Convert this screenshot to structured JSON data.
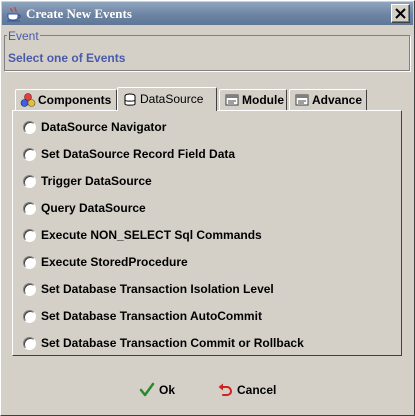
{
  "window": {
    "title": "Create New Events"
  },
  "event": {
    "legend": "Event",
    "text": "Select one of Events"
  },
  "tabs": [
    {
      "label": "Components",
      "icon": "components-icon",
      "active": false
    },
    {
      "label": "DataSource",
      "icon": "database-icon",
      "active": true
    },
    {
      "label": "Module",
      "icon": "module-icon",
      "active": false
    },
    {
      "label": "Advance",
      "icon": "advance-icon",
      "active": false
    }
  ],
  "options": [
    {
      "label": "DataSource Navigator",
      "selected": false
    },
    {
      "label": "Set DataSource Record Field Data",
      "selected": false
    },
    {
      "label": "Trigger DataSource",
      "selected": false
    },
    {
      "label": "Query DataSource",
      "selected": false
    },
    {
      "label": "Execute NON_SELECT Sql Commands",
      "selected": false
    },
    {
      "label": "Execute StoredProcedure",
      "selected": false
    },
    {
      "label": "Set Database Transaction Isolation Level",
      "selected": false
    },
    {
      "label": "Set Database Transaction AutoCommit",
      "selected": false
    },
    {
      "label": "Set Database Transaction Commit or Rollback",
      "selected": false
    }
  ],
  "buttons": {
    "ok": "Ok",
    "cancel": "Cancel"
  },
  "colors": {
    "titlebar": "#6d84a3",
    "window_bg": "#d4d0c8",
    "group_text": "#4a5aaa",
    "ok_check": "#2a8a2a",
    "cancel_arrow": "#d02020"
  }
}
